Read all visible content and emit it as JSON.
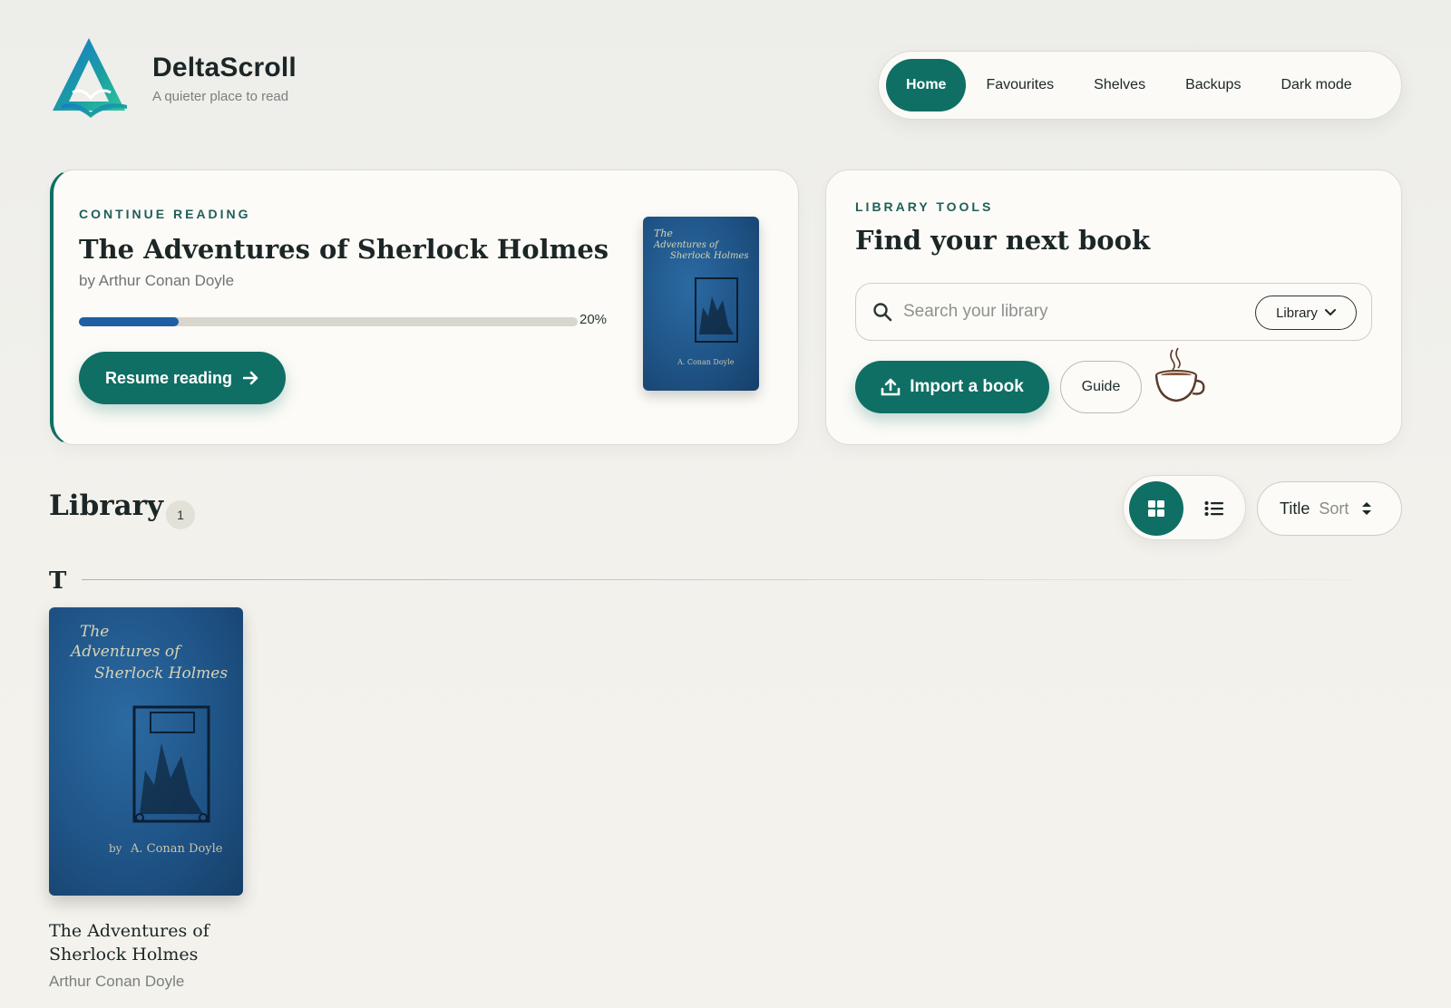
{
  "brand": {
    "name": "DeltaScroll",
    "tagline": "A quieter place to read"
  },
  "nav": {
    "items": [
      {
        "label": "Home",
        "active": true
      },
      {
        "label": "Favourites",
        "active": false
      },
      {
        "label": "Shelves",
        "active": false
      },
      {
        "label": "Backups",
        "active": false
      },
      {
        "label": "Dark mode",
        "active": false
      }
    ]
  },
  "continue_reading": {
    "eyebrow": "CONTINUE READING",
    "title": "The Adventures of Sherlock Holmes",
    "byline": "by Arthur Conan Doyle",
    "progress_percent": 20,
    "progress_label": "20%",
    "resume_label": "Resume reading"
  },
  "library_tools": {
    "eyebrow": "LIBRARY TOOLS",
    "title": "Find your next book",
    "search_placeholder": "Search your library",
    "search_value": "",
    "scope_selected": "Library",
    "import_label": "Import a book",
    "guide_label": "Guide"
  },
  "library": {
    "title": "Library",
    "count": "1",
    "sort_key": "Title",
    "sort_label": "Sort",
    "view_mode": "grid",
    "groups": [
      {
        "letter": "T",
        "books": [
          {
            "title": "The Adventures of Sherlock Holmes",
            "author": "Arthur Conan Doyle"
          }
        ]
      }
    ]
  },
  "icons": {
    "logo": "delta-book-logo-icon",
    "search": "search-icon",
    "scope": "chevron-down-icon",
    "import": "upload-icon",
    "coffee": "coffee-cup-icon",
    "grid": "grid-view-icon",
    "list": "list-view-icon",
    "sort": "sort-updown-icon",
    "resume": "arrow-right-icon"
  },
  "colors": {
    "accent": "#0f6f64",
    "progress": "#1f5ea3",
    "background": "#f2f1ec",
    "card": "#fcfbf7"
  }
}
